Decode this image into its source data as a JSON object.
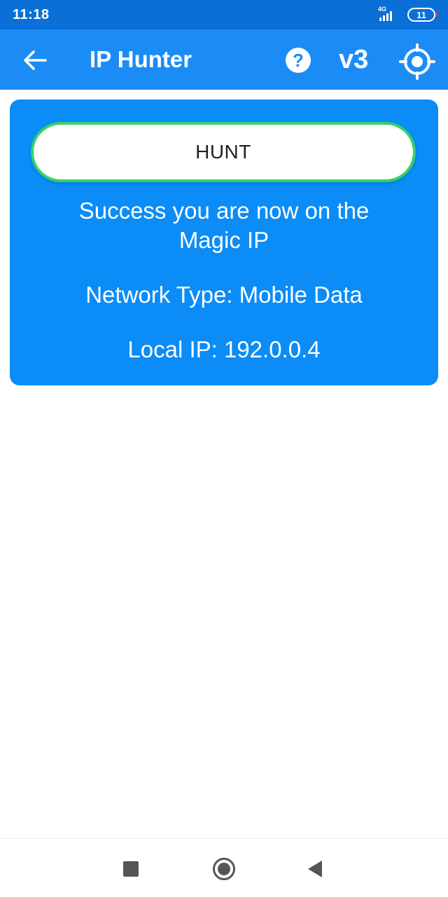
{
  "status_bar": {
    "time": "11:18",
    "network_type": "4G",
    "battery_level": "11"
  },
  "app_bar": {
    "title": "IP Hunter",
    "version_label": "v3",
    "help_glyph": "?",
    "icons": {
      "back": "arrow-left-icon",
      "help": "help-circle-icon",
      "target": "crosshair-target-icon"
    }
  },
  "card": {
    "hunt_button_label": "HUNT",
    "status_message": "Success you are now on the Magic IP",
    "network_type_line": "Network Type: Mobile Data",
    "local_ip_line": "Local IP: 192.0.0.4"
  },
  "colors": {
    "status_bar": "#0a6fd6",
    "app_bar": "#1b8cf6",
    "card": "#0b8cf7",
    "button_border": "#35d06b"
  },
  "nav_bar": {
    "icons": [
      "recents-square-icon",
      "home-circle-icon",
      "back-triangle-icon"
    ]
  }
}
